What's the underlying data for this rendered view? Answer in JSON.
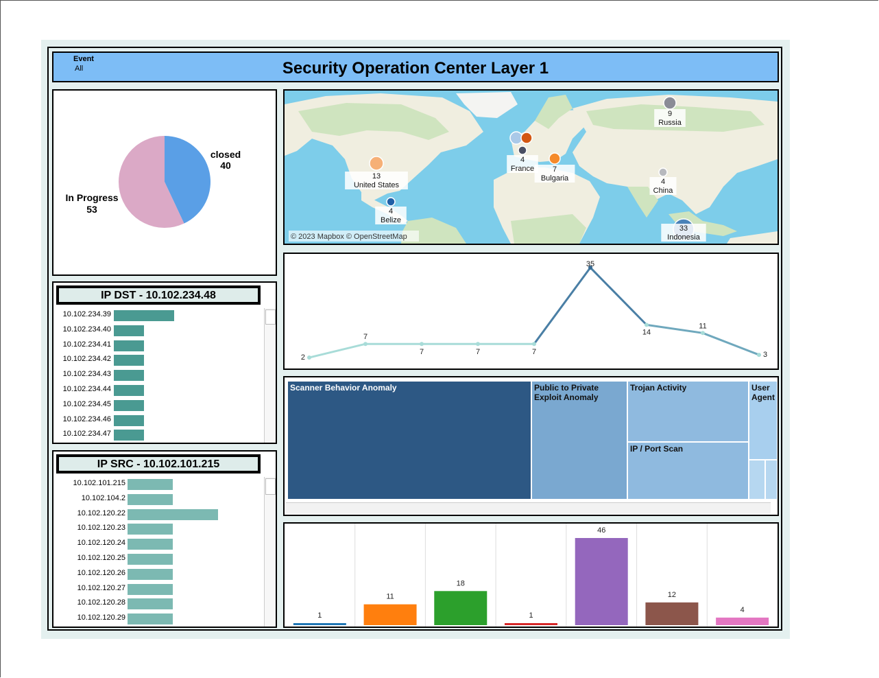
{
  "header": {
    "filter_label": "Event",
    "filter_value": "All",
    "title": "Security Operation Center Layer 1"
  },
  "colors": {
    "header_bg": "#7dbdf6",
    "panel_bg": "#e4f0ef",
    "ip_dst_bar": "#4a9a92",
    "ip_src_bar": "#7cb9b2",
    "line_light": "#a8dcd8",
    "line_dark": "#3a6c94"
  },
  "pie": {
    "chart_data": {
      "type": "pie",
      "slices": [
        {
          "label": "closed",
          "value": 40,
          "color": "#5a9fe6"
        },
        {
          "label": "In Progress",
          "value": 53,
          "color": "#dba9c6"
        }
      ]
    }
  },
  "map": {
    "attribution": "© 2023 Mapbox © OpenStreetMap",
    "markers": [
      {
        "label": "United States",
        "value": "13",
        "color": "#f6b077"
      },
      {
        "label": "Belize",
        "value": "4",
        "color": "#1f5fa6"
      },
      {
        "label": "France",
        "value": "4",
        "color": "#4a4f63"
      },
      {
        "label": "Bulgaria",
        "value": "7",
        "color": "#f58a2a"
      },
      {
        "label": "Russia",
        "value": "9",
        "color": "#8a8c96"
      },
      {
        "label": "China",
        "value": "4",
        "color": "#b7b9be"
      },
      {
        "label": "Indonesia",
        "value": "33",
        "color": "#4a82b8"
      },
      {
        "label": "",
        "value": "",
        "color": "#aac9e8"
      },
      {
        "label": "",
        "value": "",
        "color": "#d35712"
      }
    ]
  },
  "ip_dst": {
    "title": "IP DST - 10.102.234.48",
    "chart_data": {
      "type": "bar",
      "orientation": "horizontal",
      "categories": [
        "10.102.234.39",
        "10.102.234.40",
        "10.102.234.41",
        "10.102.234.42",
        "10.102.234.43",
        "10.102.234.44",
        "10.102.234.45",
        "10.102.234.46",
        "10.102.234.47"
      ],
      "values": [
        2,
        1,
        1,
        1,
        1,
        1,
        1,
        1,
        1
      ]
    }
  },
  "ip_src": {
    "title": "IP SRC - 10.102.101.215",
    "chart_data": {
      "type": "bar",
      "orientation": "horizontal",
      "categories": [
        "10.102.101.215",
        "10.102.104.2",
        "10.102.120.22",
        "10.102.120.23",
        "10.102.120.24",
        "10.102.120.25",
        "10.102.120.26",
        "10.102.120.27",
        "10.102.120.28",
        "10.102.120.29"
      ],
      "values": [
        1,
        1,
        2,
        1,
        1,
        1,
        1,
        1,
        1,
        1
      ]
    }
  },
  "line": {
    "chart_data": {
      "type": "line",
      "values": [
        2,
        7,
        7,
        7,
        7,
        35,
        14,
        11,
        3
      ]
    }
  },
  "treemap": {
    "cells": [
      {
        "label": "Scanner Behavior Anomaly",
        "color": "#2d5884",
        "text": "light"
      },
      {
        "label": "Public to Private Exploit Anomaly",
        "color": "#7aa8d0",
        "text": "dark"
      },
      {
        "label": "Trojan Activity",
        "color": "#8fbadf",
        "text": "dark"
      },
      {
        "label": "IP / Port Scan",
        "color": "#8fbadf",
        "text": "dark"
      },
      {
        "label": "User Agent",
        "color": "#a8cfee",
        "text": "dark"
      }
    ]
  },
  "bars": {
    "chart_data": {
      "type": "bar",
      "values": [
        1,
        11,
        18,
        1,
        46,
        12,
        4
      ],
      "colors": [
        "#1f77b4",
        "#ff7f0e",
        "#2ca02c",
        "#d62728",
        "#9467bd",
        "#8c564b",
        "#e377c2"
      ]
    }
  }
}
